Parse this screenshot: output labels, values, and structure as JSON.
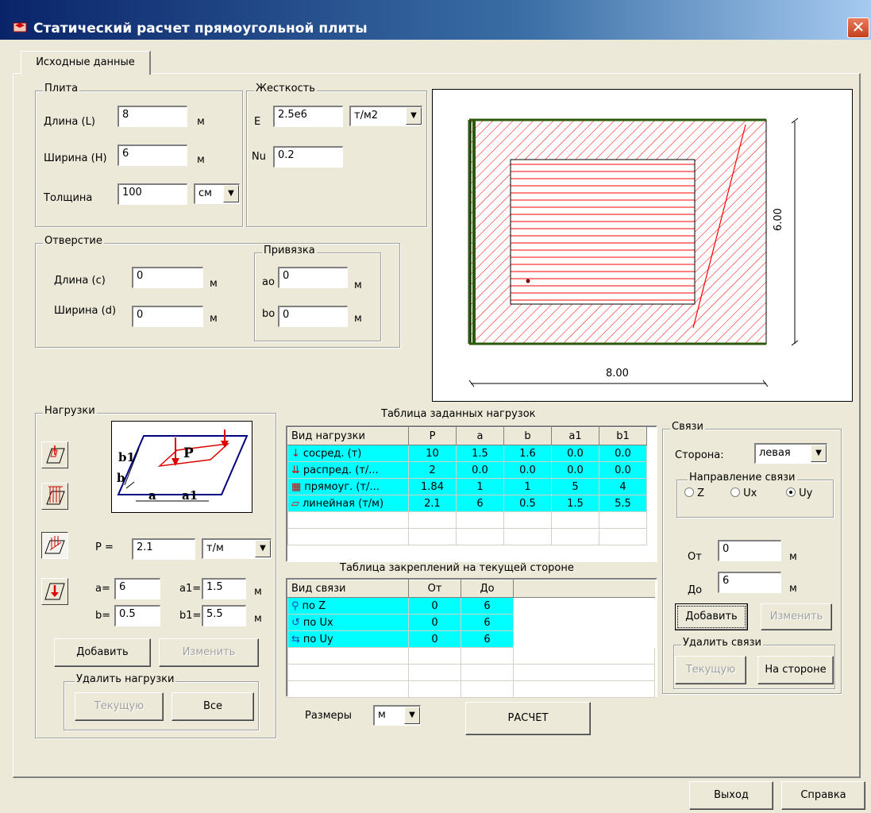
{
  "window": {
    "title": "Статический расчет прямоугольной плиты"
  },
  "tabs": [
    {
      "label": "Исходные данные"
    }
  ],
  "plate": {
    "label": "Плита",
    "length_label": "Длина (L)",
    "length_value": "8",
    "length_unit": "м",
    "width_label": "Ширина (H)",
    "width_value": "6",
    "width_unit": "м",
    "thickness_label": "Толщина",
    "thickness_value": "100",
    "thickness_unit": "см"
  },
  "stiffness": {
    "label": "Жесткость",
    "e_label": "E",
    "e_value": "2.5e6",
    "e_unit": "т/м2",
    "nu_label": "Nu",
    "nu_value": "0.2"
  },
  "opening": {
    "label": "Отверстие",
    "length_label": "Длина (c)",
    "length_value": "0",
    "length_unit": "м",
    "width_label": "Ширина (d)",
    "width_value": "0",
    "width_unit": "м"
  },
  "anchor": {
    "label": "Привязка",
    "ao_label": "ao",
    "ao_value": "0",
    "ao_unit": "м",
    "bo_label": "bo",
    "bo_value": "0",
    "bo_unit": "м"
  },
  "preview": {
    "width_dim": "8.00",
    "height_dim": "6.00"
  },
  "loads": {
    "label": "Нагрузки",
    "diagram": {
      "p": "P",
      "b1": "b1",
      "b": "b",
      "a": "a",
      "a1": "a1"
    },
    "p_label": "P  =",
    "p_value": "2.1",
    "p_unit": "т/м",
    "a_label": "a=",
    "a_value": "6",
    "a1_label": "a1=",
    "a1_value": "1.5",
    "a1_unit": "м",
    "b_label": "b=",
    "b_value": "0.5",
    "b1_label": "b1=",
    "b1_value": "5.5",
    "b1_unit": "м",
    "add_label": "Добавить",
    "edit_label": "Изменить",
    "delete_group_label": "Удалить нагрузки",
    "delete_current_label": "Текущую",
    "delete_all_label": "Все",
    "type_icons": [
      "point-load-icon",
      "distributed-load-icon",
      "linear-load-icon",
      "concentrated-load-icon"
    ]
  },
  "loads_table": {
    "title": "Таблица заданных нагрузок",
    "headers": [
      "Вид нагрузки",
      "P",
      "a",
      "b",
      "a1",
      "b1"
    ],
    "rows": [
      {
        "icon": "↓",
        "name": "сосред. (т)",
        "p": "10",
        "a": "1.5",
        "b": "1.6",
        "a1": "0.0",
        "b1": "0.0"
      },
      {
        "icon": "⇊",
        "name": "распред. (т/...",
        "p": "2",
        "a": "0.0",
        "b": "0.0",
        "a1": "0.0",
        "b1": "0.0"
      },
      {
        "icon": "▦",
        "name": "прямоуг. (т/...",
        "p": "1.84",
        "a": "1",
        "b": "1",
        "a1": "5",
        "b1": "4"
      },
      {
        "icon": "▱",
        "name": "линейная (т/м)",
        "p": "2.1",
        "a": "6",
        "b": "0.5",
        "a1": "1.5",
        "b1": "5.5"
      }
    ]
  },
  "supports_table": {
    "title": "Таблица закреплений на текущей стороне",
    "headers": [
      "Вид связи",
      "От",
      "До"
    ],
    "rows": [
      {
        "icon": "⚲",
        "name": "по Z",
        "from": "0",
        "to": "6"
      },
      {
        "icon": "↺",
        "name": "по Ux",
        "from": "0",
        "to": "6"
      },
      {
        "icon": "⇆",
        "name": "по Uy",
        "from": "0",
        "to": "6"
      }
    ]
  },
  "supports": {
    "label": "Связи",
    "side_label": "Сторона:",
    "side_value": "левая",
    "direction_label": "Направление связи",
    "directions": [
      {
        "label": "Z",
        "selected": false
      },
      {
        "label": "Ux",
        "selected": false
      },
      {
        "label": "Uy",
        "selected": true
      }
    ],
    "from_label": "От",
    "from_value": "0",
    "from_unit": "м",
    "to_label": "До",
    "to_value": "6",
    "to_unit": "м",
    "add_label": "Добавить",
    "edit_label": "Изменить",
    "delete_group_label": "Удалить связи",
    "delete_current_label": "Текущую",
    "delete_side_label": "На стороне"
  },
  "bottom": {
    "sizes_label": "Размеры",
    "sizes_value": "м",
    "calc_label": "РАСЧЕТ",
    "exit_label": "Выход",
    "help_label": "Справка"
  }
}
